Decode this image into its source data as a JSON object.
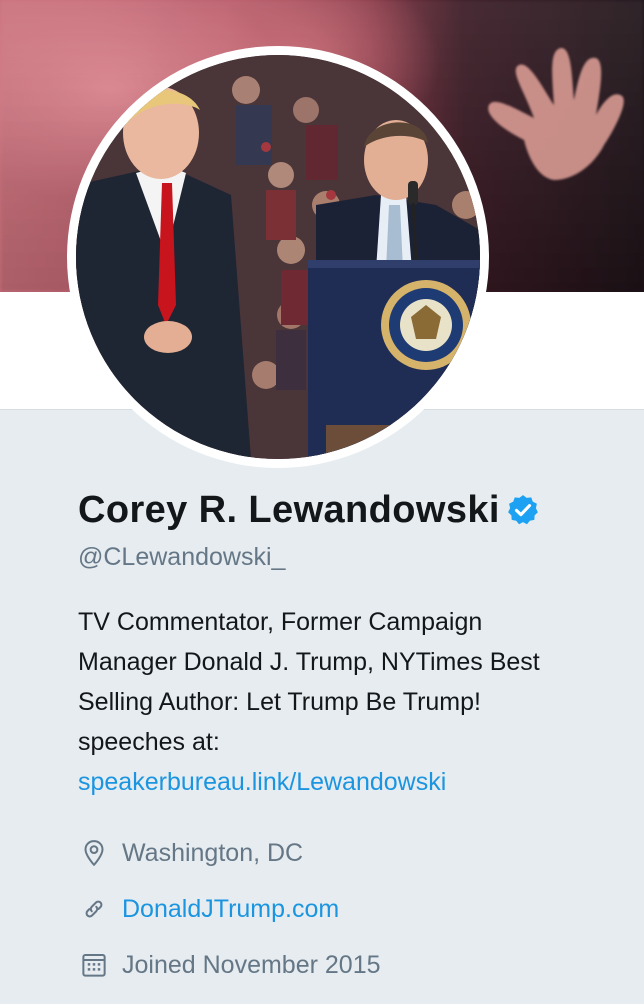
{
  "profile": {
    "display_name": "Corey R. Lewandowski",
    "handle": "@CLewandowski_",
    "verified": true,
    "bio_lines": [
      "TV Commentator, Former Campaign",
      "Manager Donald J. Trump, NYTimes Best",
      "Selling Author: Let Trump Be Trump!",
      "speeches at:"
    ],
    "bio_link": "speakerbureau.link/Lewandowski",
    "location": "Washington, DC",
    "website": "DonaldJTrump.com",
    "joined": "Joined November 2015"
  },
  "icons": {
    "verified": "verified-badge-icon",
    "location": "location-pin-icon",
    "website": "link-icon",
    "joined": "calendar-icon"
  },
  "colors": {
    "background": "#e6ecf0",
    "link": "#1b95e0",
    "secondary_text": "#657786",
    "verified_badge": "#1da1f2"
  }
}
